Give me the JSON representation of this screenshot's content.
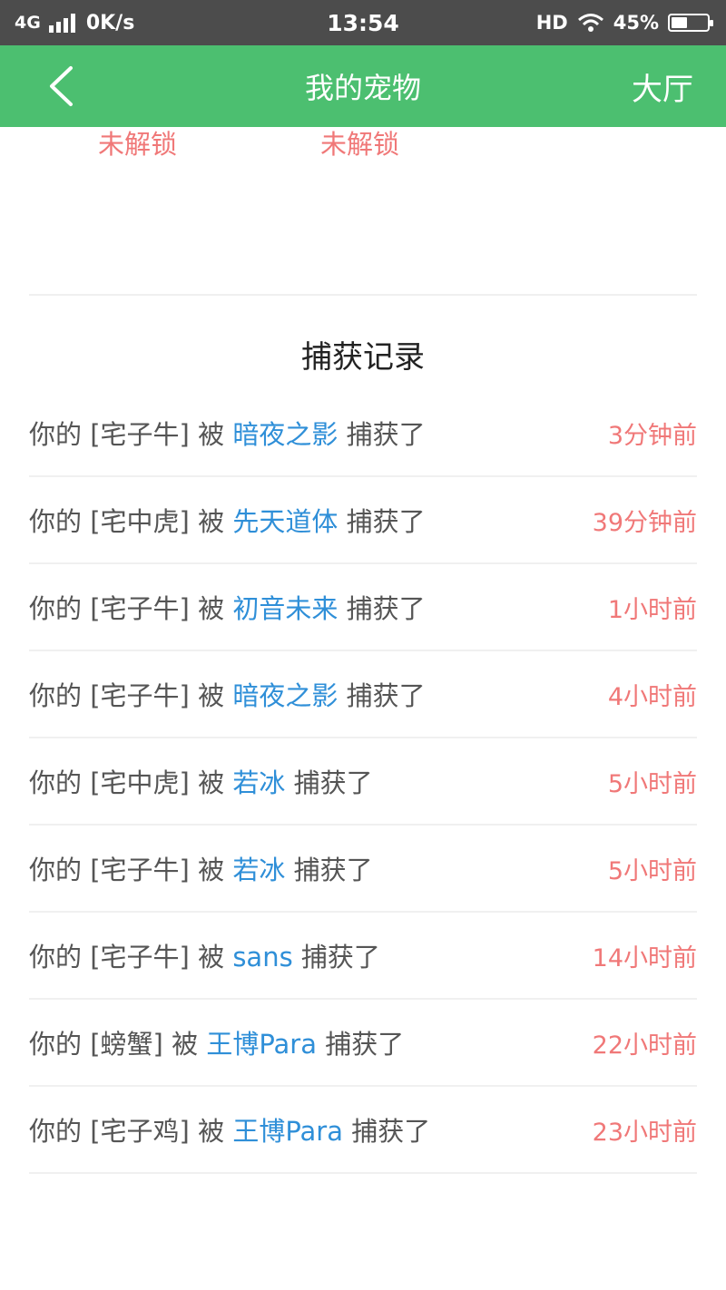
{
  "status_bar": {
    "network": "4G",
    "speed": "0K/s",
    "time": "13:54",
    "hd": "HD",
    "battery": "45%",
    "battery_level": 0.45
  },
  "nav": {
    "back_icon": "chevron-left-icon",
    "title": "我的宠物",
    "right": "大厅"
  },
  "pets": {
    "locked_labels": [
      "未解锁",
      "未解锁"
    ]
  },
  "records": {
    "title": "捕获记录",
    "items": [
      {
        "prefix": "你的",
        "pet": "[宅子牛]",
        "verb": "被",
        "catcher": "暗夜之影",
        "action": "捕获了",
        "time": "3分钟前"
      },
      {
        "prefix": "你的",
        "pet": "[宅中虎]",
        "verb": "被",
        "catcher": "先天道体",
        "action": "捕获了",
        "time": "39分钟前"
      },
      {
        "prefix": "你的",
        "pet": "[宅子牛]",
        "verb": "被",
        "catcher": "初音未来",
        "action": "捕获了",
        "time": "1小时前"
      },
      {
        "prefix": "你的",
        "pet": "[宅子牛]",
        "verb": "被",
        "catcher": "暗夜之影",
        "action": "捕获了",
        "time": "4小时前"
      },
      {
        "prefix": "你的",
        "pet": "[宅中虎]",
        "verb": "被",
        "catcher": "若冰",
        "action": "捕获了",
        "time": "5小时前"
      },
      {
        "prefix": "你的",
        "pet": "[宅子牛]",
        "verb": "被",
        "catcher": "若冰",
        "action": "捕获了",
        "time": "5小时前"
      },
      {
        "prefix": "你的",
        "pet": "[宅子牛]",
        "verb": "被",
        "catcher": "sans",
        "action": "捕获了",
        "time": "14小时前"
      },
      {
        "prefix": "你的",
        "pet": "[螃蟹]",
        "verb": "被",
        "catcher": "王博Para",
        "action": "捕获了",
        "time": "22小时前"
      },
      {
        "prefix": "你的",
        "pet": "[宅子鸡]",
        "verb": "被",
        "catcher": "王博Para",
        "action": "捕获了",
        "time": "23小时前"
      }
    ]
  },
  "colors": {
    "nav_green": "#4cbf70",
    "catcher_blue": "#2f8fd8",
    "time_red": "#f07878"
  }
}
